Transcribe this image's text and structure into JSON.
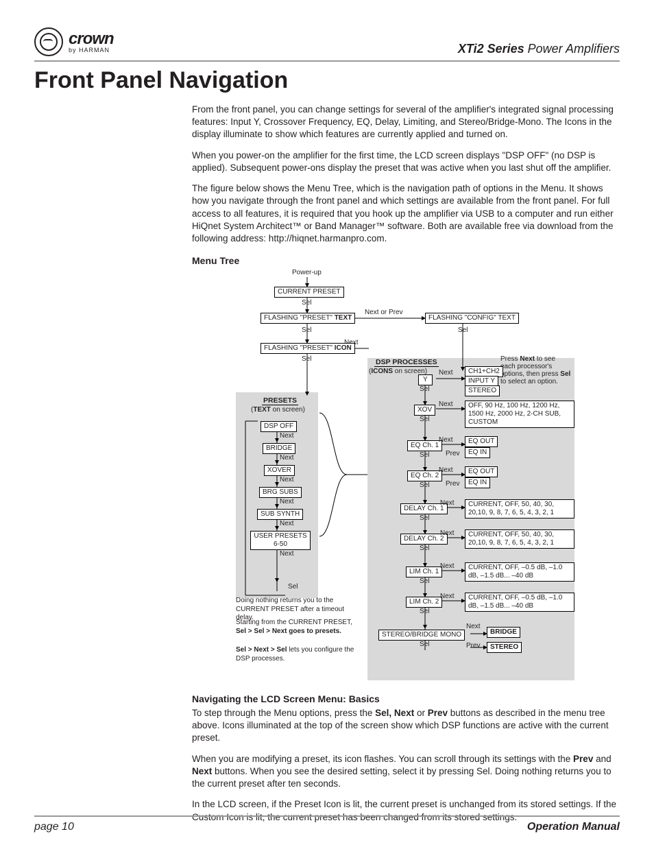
{
  "brand": {
    "crown": "crown",
    "by": "by HARMAN"
  },
  "series": {
    "em": "XTi2 Series",
    "rest": " Power Amplifiers"
  },
  "heading": "Front Panel Navigation",
  "intro": {
    "p1": "From the front panel, you can change settings for several of the amplifier's integrated signal processing features: Input Y, Crossover Frequency, EQ, Delay, Limiting, and Stereo/Bridge-Mono. The Icons in the display illuminate to show which features are currently applied and turned on.",
    "p2": "When you power-on the amplifier for the first time, the LCD screen displays \"DSP OFF\" (no DSP is applied). Subsequent power-ons display the preset that was active when you last shut off the amplifier.",
    "p3": "The figure below shows the Menu Tree, which is the navigation path of options in the Menu. It shows how you navigate through the front panel and which settings are available from the front panel. For full access to all features, it is required that you hook up the amplifier via USB to a computer and run either HiQnet System Architect™ or Band Manager™ software. Both are available free via download from the following address: http://hiqnet.harmanpro.com."
  },
  "menutree_title": "Menu Tree",
  "diagram": {
    "powerup": "Power-up",
    "current_preset": "CURRENT PRESET",
    "flashing_preset_text": "FLASHING \"PRESET\"",
    "flashing_preset_text_suffix": "TEXT",
    "next_or_prev": "Next or Prev",
    "flashing_config_text": "FLASHING \"CONFIG\" TEXT",
    "flashing_preset_icon": "FLASHING \"PRESET\"",
    "flashing_preset_icon_suffix": "ICON",
    "sel": "Sel",
    "next": "Next",
    "prev": "Prev",
    "presets_title": "PRESETS",
    "text_on_screen": "(TEXT on screen)",
    "dsp_title": "DSP PROCESSES",
    "icons_on_screen": "(ICONS on screen)",
    "press_next_note": "Press Next to see each processor's options, then press Sel to select an option.",
    "left_chain": [
      "DSP OFF",
      "BRIDGE",
      "XOVER",
      "BRG SUBS",
      "SUB SYNTH",
      "USER PRESETS 6-50"
    ],
    "y": "Y",
    "y_opts": [
      "CH1+CH2",
      "INPUT Y",
      "STEREO"
    ],
    "xov": "XOV",
    "xov_opts": "OFF, 90 Hz, 100 Hz, 1200 Hz, 1500 Hz, 2000 Hz, 2-CH SUB, CUSTOM",
    "eq_ch1": "EQ Ch. 1",
    "eq_ch2": "EQ Ch. 2",
    "eq_out": "EQ OUT",
    "eq_in": "EQ IN",
    "delay_ch1": "DELAY Ch. 1",
    "delay_ch2": "DELAY Ch. 2",
    "delay_opts": "CURRENT, OFF, 50, 40, 30, 20,10, 9, 8, 7, 6, 5, 4, 3, 2, 1",
    "lim_ch1": "LIM Ch. 1",
    "lim_ch2": "LIM Ch. 2",
    "lim_opts": "CURRENT, OFF, –0.5 dB, –1.0 dB, –1.5 dB... –40 dB",
    "stereo_bridge_mono": "STEREO/BRIDGE MONO",
    "bridge": "BRIDGE",
    "stereo": "STEREO",
    "note1a": "Doing nothing returns you to the CURRENT PRESET after a timeout delay.",
    "note1b_prefix": "Starting from the CURRENT PRESET,",
    "note1c": "Sel > Sel > Next goes to presets.",
    "note2_prefix": "Sel > Next > Sel",
    "note2_suffix": " lets you configure the DSP processes."
  },
  "nav_basics": {
    "title": "Navigating the LCD Screen Menu: Basics",
    "p1_a": "To step through the Menu options, press the ",
    "p1_b": "Sel,  Next",
    "p1_c": " or ",
    "p1_d": "Prev",
    "p1_e": " buttons as described in the menu tree above.   Icons illuminated at the top of the screen show which DSP functions are active with the current preset.",
    "p2_a": "When you are modifying a preset, its icon flashes. You can scroll through its settings with the ",
    "p2_b": "Prev",
    "p2_c": " and ",
    "p2_d": "Next",
    "p2_e": " buttons. When you see the desired setting, select it by pressing Sel. Doing nothing returns you to the current preset after ten seconds.",
    "p3": "In the LCD screen, if the Preset Icon is lit, the current preset is unchanged from its stored settings. If the Custom Icon is lit, the current preset has been changed from its stored settings."
  },
  "footer": {
    "page": "page 10",
    "manual": "Operation Manual"
  }
}
